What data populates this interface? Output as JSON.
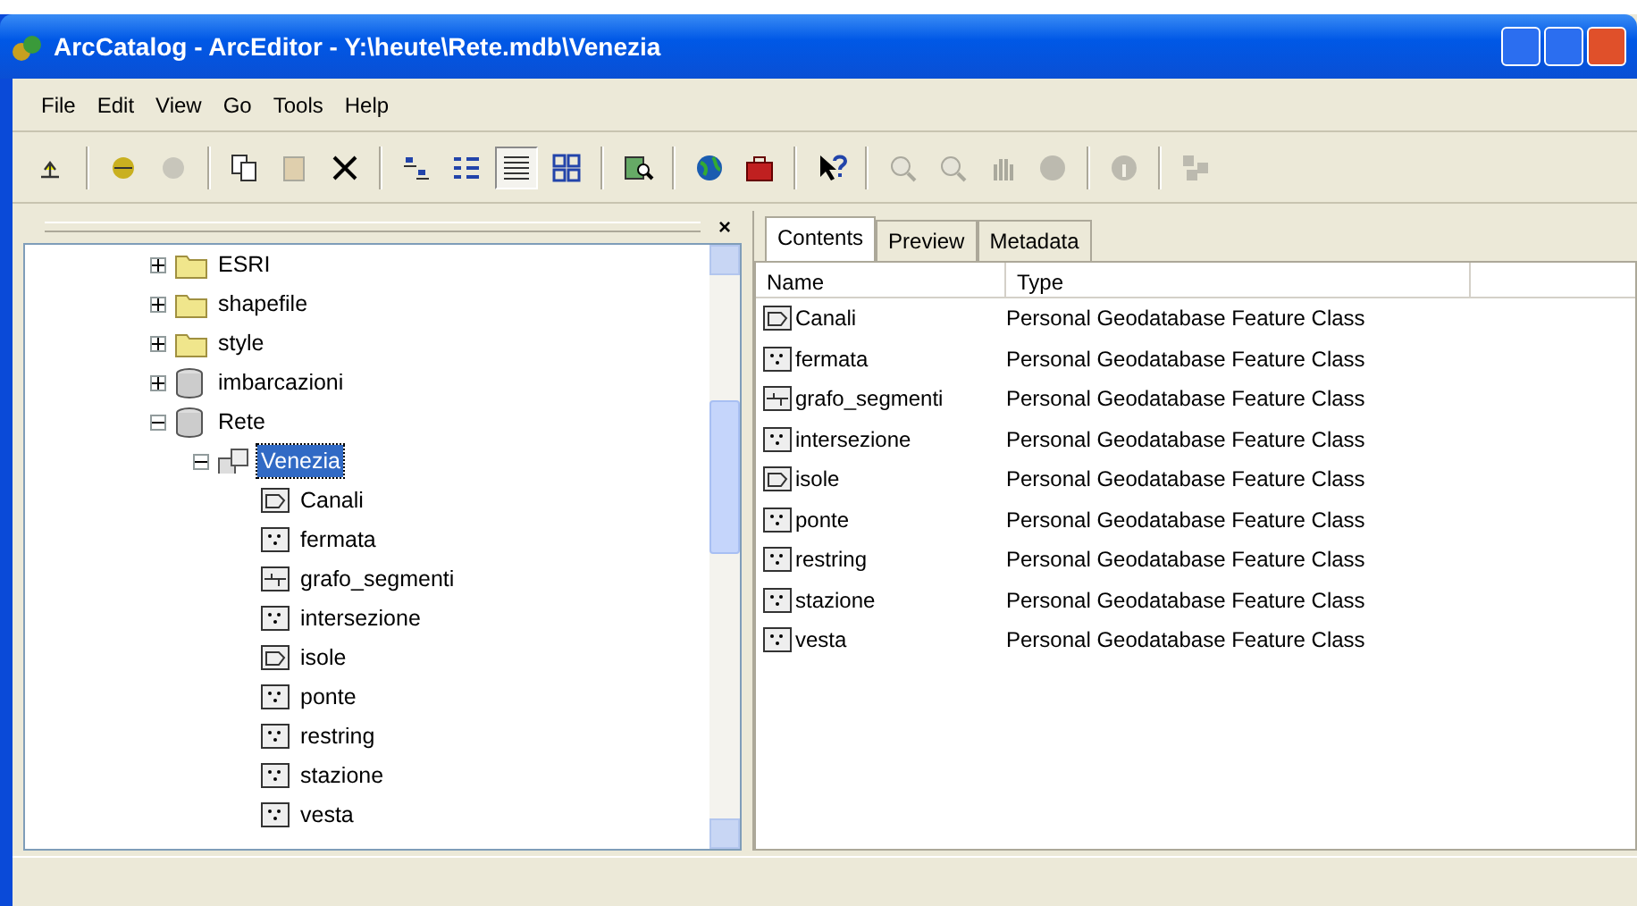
{
  "window": {
    "title": "ArcCatalog - ArcEditor - Y:\\heute\\Rete.mdb\\Venezia"
  },
  "menu": [
    "File",
    "Edit",
    "View",
    "Go",
    "Tools",
    "Help"
  ],
  "toolbar": [
    {
      "buttons": [
        {
          "kind": "up",
          "disabled": false,
          "selected": false
        }
      ]
    },
    {
      "buttons": [
        {
          "kind": "connect",
          "disabled": false,
          "selected": false
        },
        {
          "kind": "disconnect",
          "disabled": true,
          "selected": false
        }
      ]
    },
    {
      "buttons": [
        {
          "kind": "copy",
          "disabled": false,
          "selected": false
        },
        {
          "kind": "paste",
          "disabled": true,
          "selected": false
        },
        {
          "kind": "delete",
          "disabled": false,
          "selected": false
        }
      ]
    },
    {
      "buttons": [
        {
          "kind": "large-icons",
          "disabled": false,
          "selected": false
        },
        {
          "kind": "list",
          "disabled": false,
          "selected": false
        },
        {
          "kind": "details",
          "disabled": false,
          "selected": true
        },
        {
          "kind": "thumbnails",
          "disabled": false,
          "selected": false
        }
      ]
    },
    {
      "buttons": [
        {
          "kind": "search",
          "disabled": false,
          "selected": false
        }
      ]
    },
    {
      "buttons": [
        {
          "kind": "globe",
          "disabled": false,
          "selected": false
        },
        {
          "kind": "toolbox",
          "disabled": false,
          "selected": false
        }
      ]
    },
    {
      "buttons": [
        {
          "kind": "help",
          "disabled": false,
          "selected": false
        }
      ]
    },
    {
      "buttons": [
        {
          "kind": "zoom-in",
          "disabled": true,
          "selected": false
        },
        {
          "kind": "zoom-out",
          "disabled": true,
          "selected": false
        },
        {
          "kind": "pan",
          "disabled": true,
          "selected": false
        },
        {
          "kind": "full-extent",
          "disabled": true,
          "selected": false
        }
      ]
    },
    {
      "buttons": [
        {
          "kind": "identify",
          "disabled": true,
          "selected": false
        }
      ]
    },
    {
      "buttons": [
        {
          "kind": "thumbnail",
          "disabled": true,
          "selected": false
        }
      ]
    }
  ],
  "tree_pane": {
    "close": "×"
  },
  "tree": [
    {
      "label": "ESRI",
      "kind": "folder",
      "expanded": false,
      "selected": false
    },
    {
      "label": "shapefile",
      "kind": "folder",
      "expanded": false,
      "selected": false
    },
    {
      "label": "style",
      "kind": "folder",
      "expanded": false,
      "selected": false
    },
    {
      "label": "imbarcazioni",
      "kind": "database",
      "expanded": false,
      "selected": false
    },
    {
      "label": "Rete",
      "kind": "database",
      "expanded": true,
      "selected": false,
      "children": [
        {
          "label": "Venezia",
          "kind": "dataset",
          "expanded": true,
          "selected": true,
          "children": [
            {
              "label": "Canali",
              "kind": "polygon",
              "selected": false
            },
            {
              "label": "fermata",
              "kind": "point",
              "selected": false
            },
            {
              "label": "grafo_segmenti",
              "kind": "line",
              "selected": false
            },
            {
              "label": "intersezione",
              "kind": "point",
              "selected": false
            },
            {
              "label": "isole",
              "kind": "polygon",
              "selected": false
            },
            {
              "label": "ponte",
              "kind": "point",
              "selected": false
            },
            {
              "label": "restring",
              "kind": "point",
              "selected": false
            },
            {
              "label": "stazione",
              "kind": "point",
              "selected": false
            },
            {
              "label": "vesta",
              "kind": "point",
              "selected": false
            }
          ]
        }
      ]
    }
  ],
  "tabs": [
    {
      "label": "Contents",
      "selected": true
    },
    {
      "label": "Preview",
      "selected": false
    },
    {
      "label": "Metadata",
      "selected": false
    }
  ],
  "table": {
    "columns": [
      "Name",
      "Type"
    ],
    "rows": [
      {
        "kind": "polygon",
        "name": "Canali",
        "type": "Personal Geodatabase Feature Class"
      },
      {
        "kind": "point",
        "name": "fermata",
        "type": "Personal Geodatabase Feature Class"
      },
      {
        "kind": "line",
        "name": "grafo_segmenti",
        "type": "Personal Geodatabase Feature Class"
      },
      {
        "kind": "point",
        "name": "intersezione",
        "type": "Personal Geodatabase Feature Class"
      },
      {
        "kind": "polygon",
        "name": "isole",
        "type": "Personal Geodatabase Feature Class"
      },
      {
        "kind": "point",
        "name": "ponte",
        "type": "Personal Geodatabase Feature Class"
      },
      {
        "kind": "point",
        "name": "restring",
        "type": "Personal Geodatabase Feature Class"
      },
      {
        "kind": "point",
        "name": "stazione",
        "type": "Personal Geodatabase Feature Class"
      },
      {
        "kind": "point",
        "name": "vesta",
        "type": "Personal Geodatabase Feature Class"
      }
    ]
  }
}
